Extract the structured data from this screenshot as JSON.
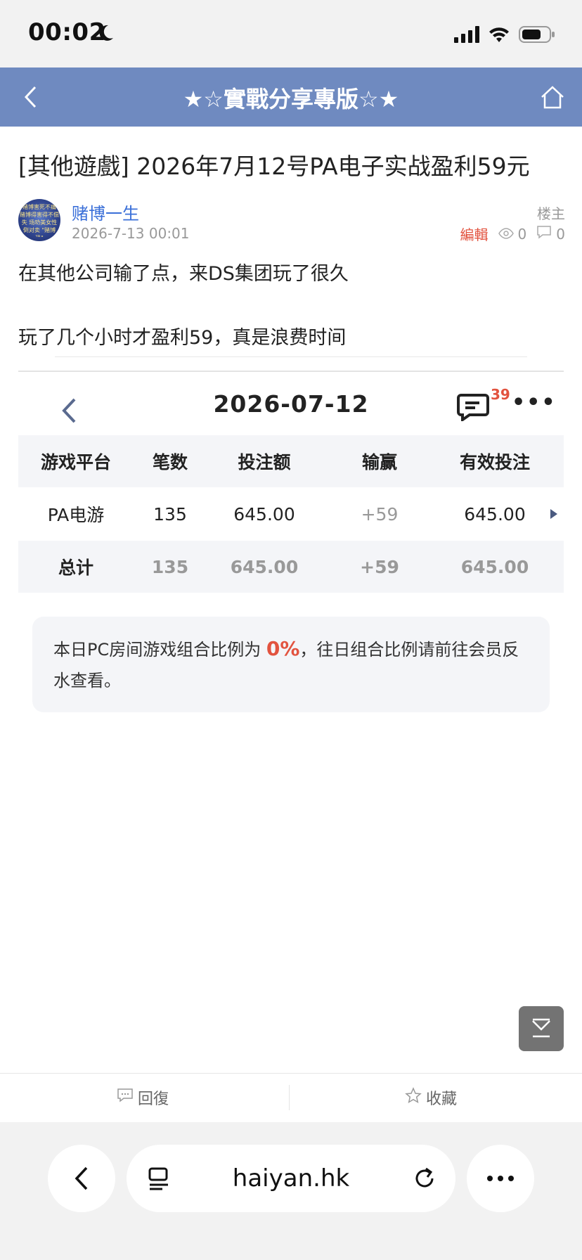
{
  "status": {
    "time": "00:02"
  },
  "nav": {
    "title": "★☆實戰分享專版☆★"
  },
  "post": {
    "title": "[其他遊戲] 2026年7月12号PA电子实战盈利59元",
    "author": "赌博一生",
    "date": "2026-7-13 00:01",
    "floor": "楼主",
    "edit": "編輯",
    "views": "0",
    "comments": "0",
    "body": [
      "在其他公司输了点，来DS集团玩了很久",
      "玩了几个小时才盈利59，真是浪费时间"
    ],
    "avatar_text": "赌博害死不痛 赌博得害得不偿失 场劝美女性倒对卖 \"赌博恐\""
  },
  "screenshot": {
    "date": "2026-07-12",
    "chat_badge": "39",
    "headers": [
      "游戏平台",
      "笔数",
      "投注额",
      "输赢",
      "有效投注"
    ],
    "row": [
      "PA电游",
      "135",
      "645.00",
      "+59",
      "645.00"
    ],
    "total": [
      "总计",
      "135",
      "645.00",
      "+59",
      "645.00"
    ],
    "notice_pre": "本日PC房间游戏组合比例为",
    "notice_pct": "0%",
    "notice_post": "，往日组合比例请前往会员反水查看。"
  },
  "actions": {
    "reply": "回復",
    "favorite": "收藏"
  },
  "browser": {
    "domain": "haiyan.hk"
  },
  "colors": {
    "nav_bg": "#6f8ac0",
    "accent_red": "#e2533f",
    "link_blue": "#3a6fd8"
  }
}
